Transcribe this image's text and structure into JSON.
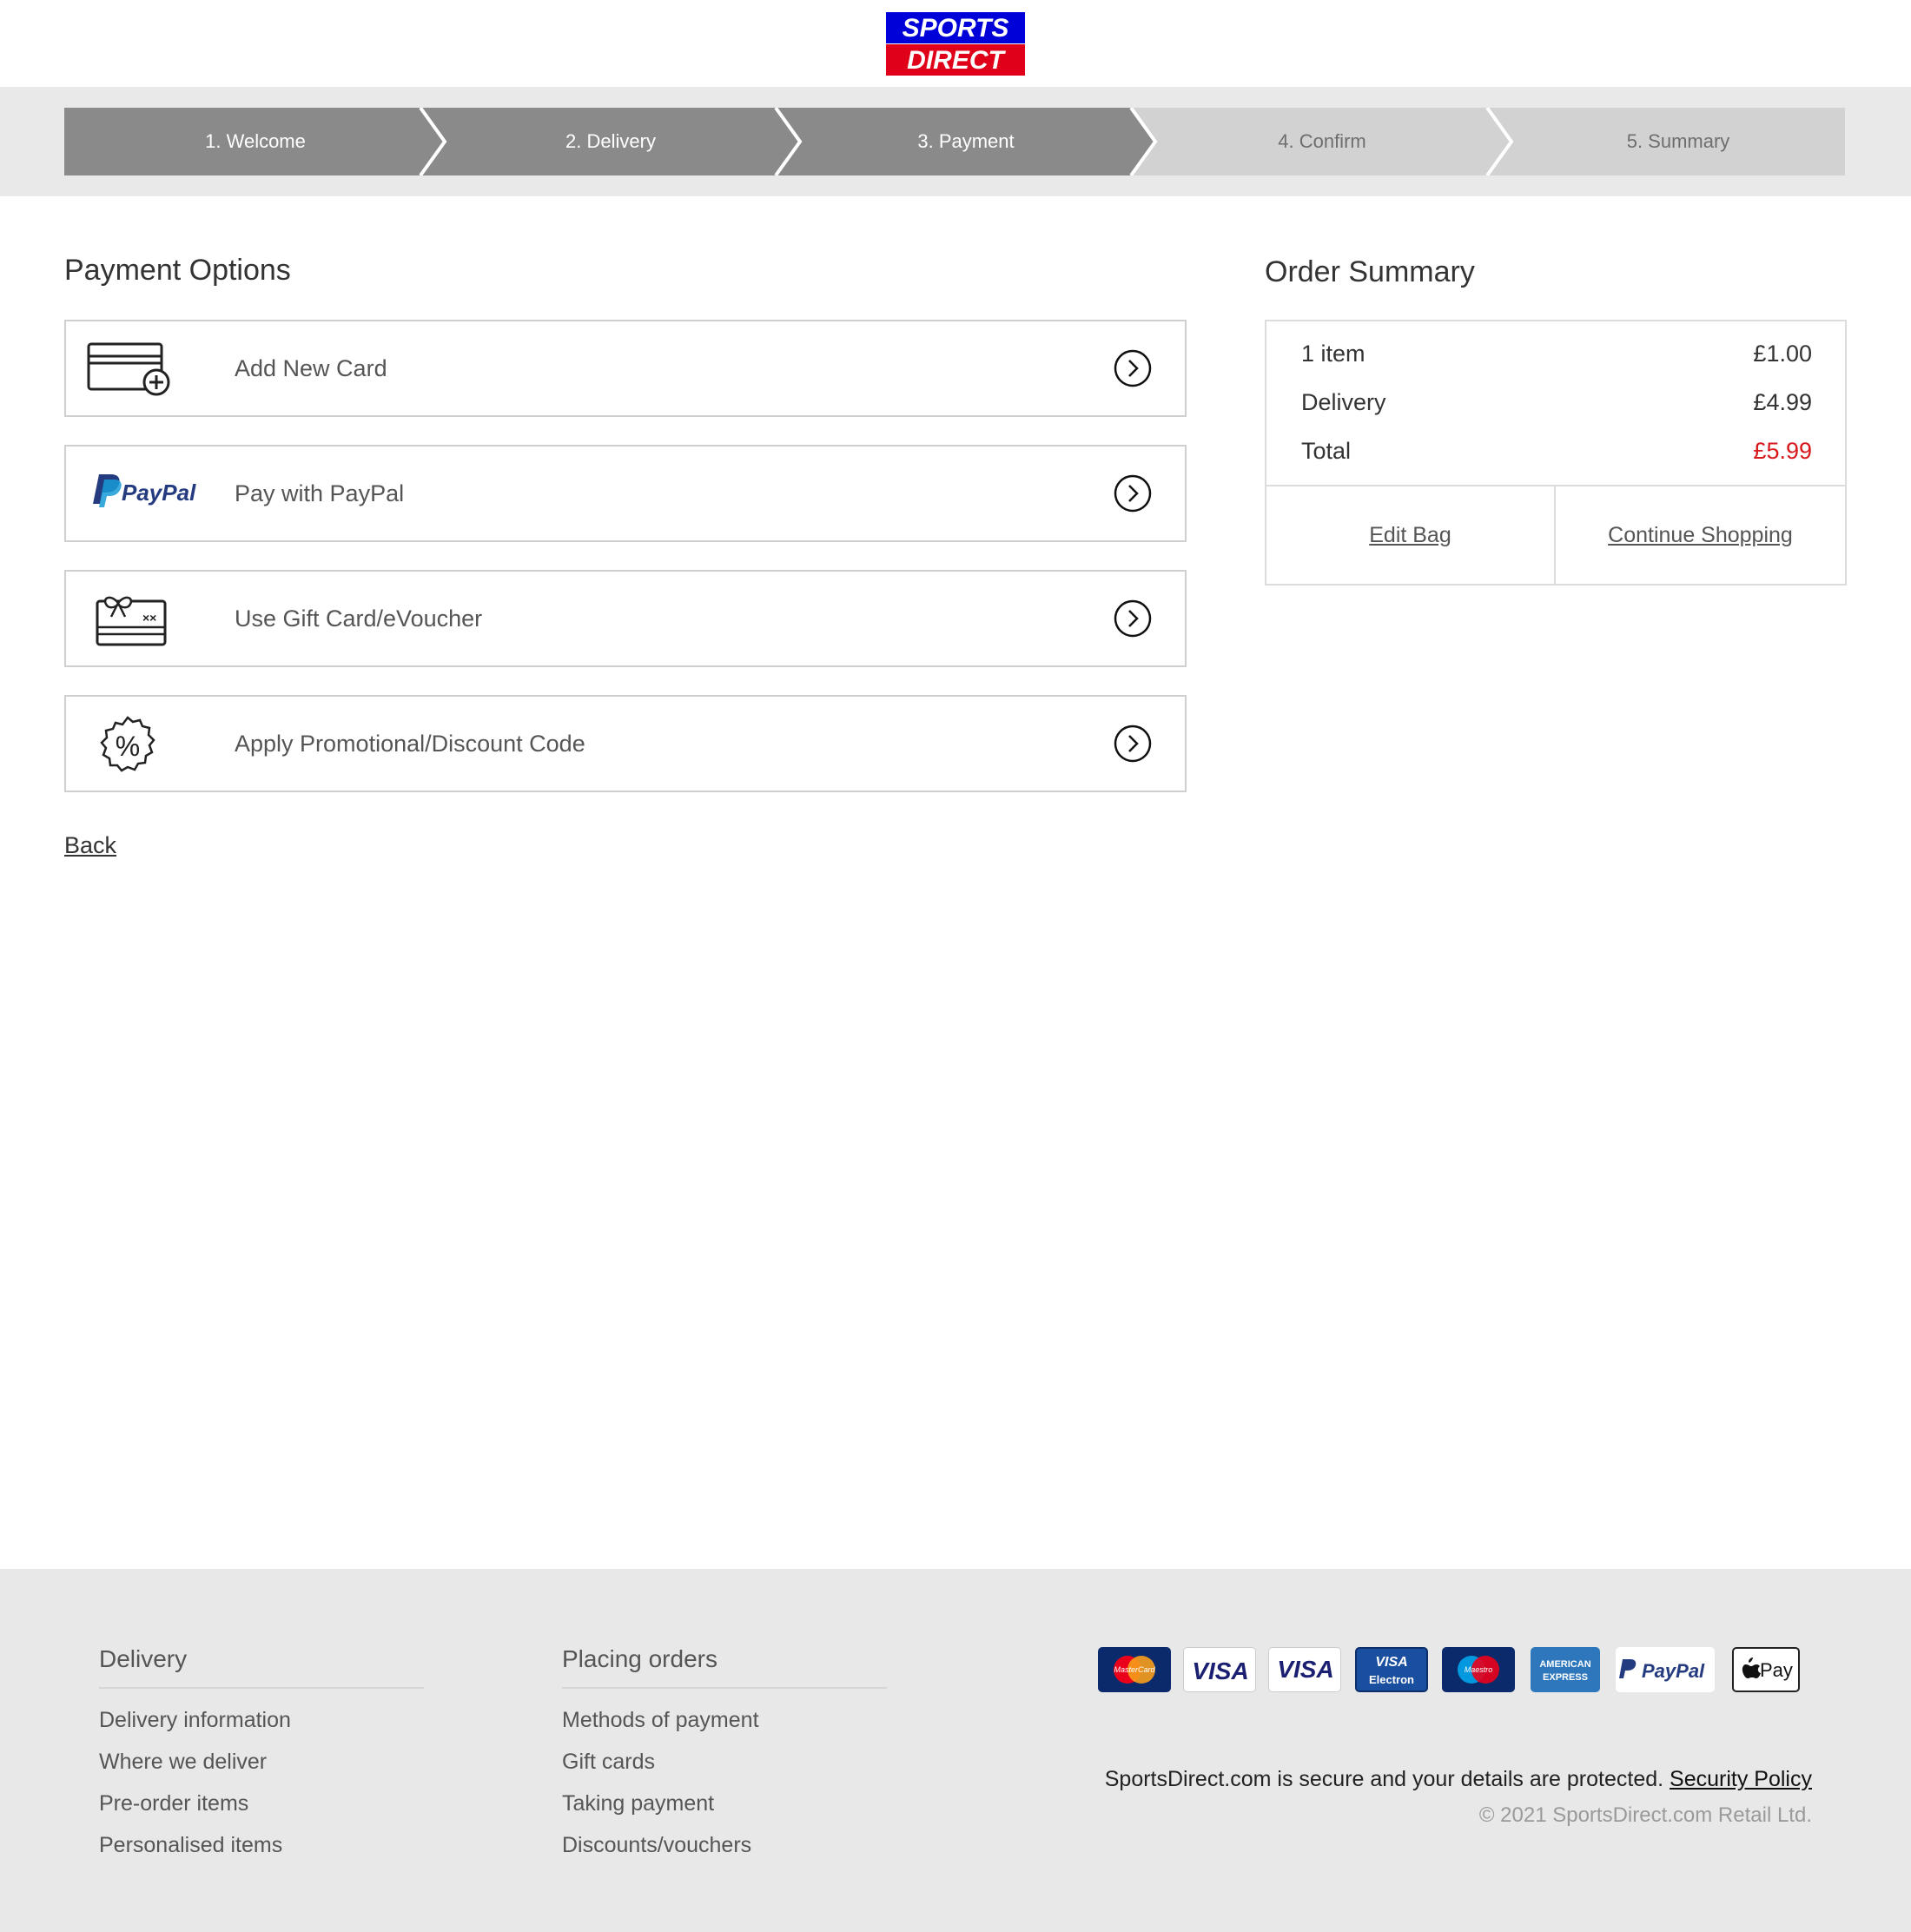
{
  "brand": {
    "line1": "SPORTS",
    "line2": "DIRECT",
    "blue": "#0000d8",
    "red": "#e0001a"
  },
  "steps": [
    {
      "label": "1. Welcome",
      "state": "done"
    },
    {
      "label": "2. Delivery",
      "state": "done"
    },
    {
      "label": "3. Payment",
      "state": "current"
    },
    {
      "label": "4. Confirm",
      "state": "todo"
    },
    {
      "label": "5. Summary",
      "state": "todo"
    }
  ],
  "payment": {
    "title": "Payment Options",
    "options": [
      {
        "label": "Add New Card",
        "icon": "credit-card-add-icon"
      },
      {
        "label": "Pay with PayPal",
        "icon": "paypal-logo"
      },
      {
        "label": "Use Gift Card/eVoucher",
        "icon": "gift-card-icon"
      },
      {
        "label": "Apply Promotional/Discount Code",
        "icon": "percent-badge-icon"
      }
    ],
    "paypal_logo_text": "PayPal",
    "back_label": "Back"
  },
  "summary": {
    "title": "Order Summary",
    "rows": [
      {
        "label": "1 item",
        "value": "£1.00"
      },
      {
        "label": "Delivery",
        "value": "£4.99"
      },
      {
        "label": "Total",
        "value": "£5.99"
      }
    ],
    "edit_bag": "Edit Bag",
    "continue_shopping": "Continue Shopping",
    "total_color": "#d7191c"
  },
  "footer": {
    "col1": {
      "title": "Delivery",
      "links": [
        "Delivery information",
        "Where we deliver",
        "Pre-order items",
        "Personalised items"
      ]
    },
    "col2": {
      "title": "Placing orders",
      "links": [
        "Methods of payment",
        "Gift cards",
        "Taking payment",
        "Discounts/vouchers"
      ]
    },
    "payment_badges": [
      {
        "name": "mastercard",
        "text": "MasterCard"
      },
      {
        "name": "visa",
        "text": "VISA"
      },
      {
        "name": "visa-debit",
        "text": "VISA"
      },
      {
        "name": "visa-electron",
        "text": "VISA",
        "subtext": "Electron"
      },
      {
        "name": "maestro",
        "text": "Maestro"
      },
      {
        "name": "american-express",
        "text": "AMERICAN",
        "subtext": "EXPRESS"
      },
      {
        "name": "paypal",
        "text": "PayPal"
      },
      {
        "name": "apple-pay",
        "text": "Pay"
      }
    ],
    "secure_text": "SportsDirect.com is secure and your details are protected.",
    "security_link": "Security Policy",
    "copyright": "© 2021 SportsDirect.com Retail Ltd."
  }
}
